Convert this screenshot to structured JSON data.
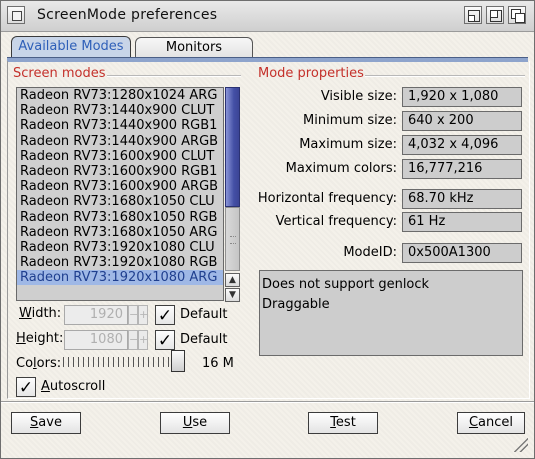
{
  "window": {
    "title": "ScreenMode preferences"
  },
  "tabs": [
    {
      "label": "Available Modes",
      "active": true
    },
    {
      "label": "Monitors",
      "active": false
    }
  ],
  "screen_modes": {
    "heading": "Screen modes",
    "items": [
      "Radeon RV73:1280x1024 ARG",
      "Radeon RV73:1440x900 CLUT",
      "Radeon RV73:1440x900 RGB1",
      "Radeon RV73:1440x900 ARGB",
      "Radeon RV73:1600x900 CLUT",
      "Radeon RV73:1600x900 RGB1",
      "Radeon RV73:1600x900 ARGB",
      "Radeon RV73:1680x1050 CLU",
      "Radeon RV73:1680x1050 RGB",
      "Radeon RV73:1680x1050 ARG",
      "Radeon RV73:1920x1080 CLU",
      "Radeon RV73:1920x1080 RGB",
      "Radeon RV73:1920x1080 ARG"
    ],
    "selected_index": 12
  },
  "width": {
    "label_underlined": "W",
    "label_rest": "idth:",
    "value": "1920",
    "default_label": "Default",
    "default_checked": true
  },
  "height": {
    "label_underlined": "H",
    "label_rest": "eight:",
    "value": "1080",
    "default_label": "Default",
    "default_checked": true
  },
  "colors": {
    "label_before": "Co",
    "label_underlined": "l",
    "label_after": "ors:",
    "value_text": "16 M",
    "level": 1.0
  },
  "autoscroll": {
    "label_underlined": "A",
    "label_rest": "utoscroll",
    "checked": true
  },
  "mode_properties": {
    "heading": "Mode properties",
    "visible_size_label": "Visible size:",
    "visible_size": "1,920 x 1,080",
    "minimum_size_label": "Minimum size:",
    "minimum_size": "640 x 200",
    "maximum_size_label": "Maximum size:",
    "maximum_size": "4,032 x 4,096",
    "maximum_colors_label": "Maximum colors:",
    "maximum_colors": "16,777,216",
    "hfreq_label": "Horizontal frequency:",
    "hfreq": "68.70 kHz",
    "vfreq_label": "Vertical frequency:",
    "vfreq": "61 Hz",
    "modeid_label": "ModeID:",
    "modeid": "0x500A1300",
    "notes": [
      "Does not support genlock",
      "Draggable"
    ]
  },
  "buttons": {
    "save_u": "S",
    "save_rest": "ave",
    "use_u": "U",
    "use_rest": "se",
    "test_u": "T",
    "test_rest": "est",
    "cancel_u": "C",
    "cancel_rest": "ancel"
  },
  "colors_theme": {
    "accent_red": "#c4302a",
    "tab_blue": "#2e5fb8",
    "selection": "#9fb8e6",
    "scroll_thumb": "#4450a6"
  }
}
